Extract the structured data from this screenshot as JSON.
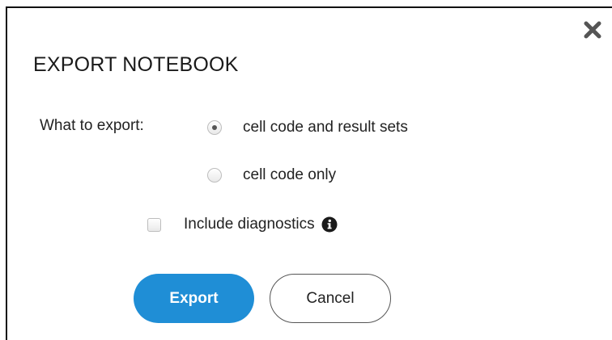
{
  "dialog": {
    "title": "EXPORT NOTEBOOK",
    "close_icon": "close-icon"
  },
  "export_options": {
    "label": "What to export:",
    "options": [
      {
        "label": "cell code and result sets",
        "selected": true
      },
      {
        "label": "cell code only",
        "selected": false
      }
    ]
  },
  "diagnostics": {
    "label": "Include diagnostics",
    "checked": false,
    "info_icon": "info-icon"
  },
  "buttons": {
    "export_label": "Export",
    "cancel_label": "Cancel"
  },
  "colors": {
    "primary": "#1f8ed6",
    "text": "#222222",
    "border": "#555555"
  }
}
